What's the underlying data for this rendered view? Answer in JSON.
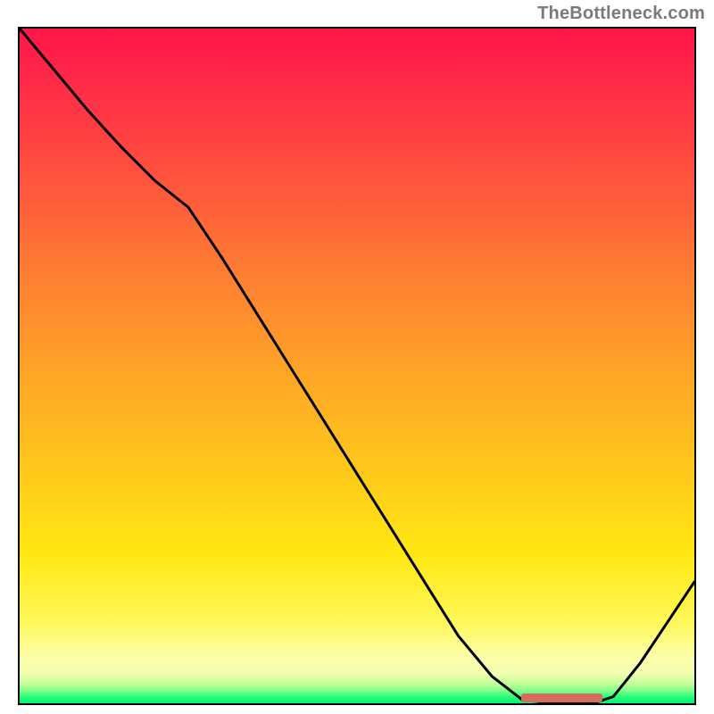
{
  "attribution": "TheBottleneck.com",
  "chart_data": {
    "type": "line",
    "title": "",
    "xlabel": "",
    "ylabel": "",
    "x": [
      0.0,
      0.05,
      0.1,
      0.15,
      0.2,
      0.25,
      0.3,
      0.35,
      0.4,
      0.45,
      0.5,
      0.55,
      0.6,
      0.65,
      0.7,
      0.745,
      0.79,
      0.85,
      0.88,
      0.92,
      0.96,
      1.0
    ],
    "values": [
      1.0,
      0.94,
      0.88,
      0.825,
      0.775,
      0.735,
      0.66,
      0.58,
      0.5,
      0.42,
      0.34,
      0.26,
      0.18,
      0.1,
      0.04,
      0.005,
      0.0,
      0.0,
      0.01,
      0.06,
      0.12,
      0.18
    ],
    "marker_xrange": [
      0.745,
      0.865
    ],
    "marker_y": 0.006,
    "ylim": [
      0,
      1
    ],
    "xlim": [
      0,
      1
    ],
    "background": "vertical-gradient red→yellow→green",
    "note": "x and y are normalized to plot interior; no axis ticks or labels are visible"
  },
  "colors": {
    "curve": "#000000",
    "marker": "#d96b5e",
    "frame": "#000000"
  }
}
